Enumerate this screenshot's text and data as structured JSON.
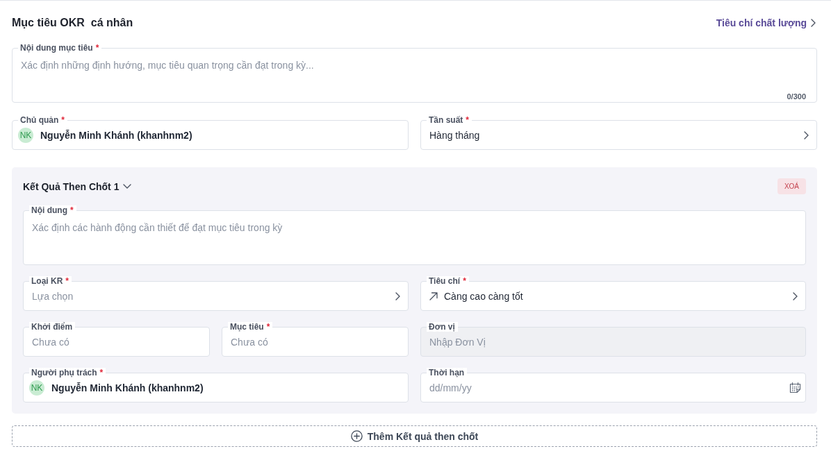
{
  "header": {
    "title": "Mục tiêu OKR  cá nhân",
    "link": "Tiêu chí chất lượng"
  },
  "objective": {
    "label": "Nội dung mục tiêu",
    "required_mark": "*",
    "placeholder": "Xác định những định hướng, mục tiêu quan trọng cần đạt trong kỳ...",
    "counter": "0/300"
  },
  "objective_fields": [
    {
      "kind": "person",
      "label": "Chủ quản",
      "required_mark": "*",
      "avatar": "NK",
      "value": "Nguyễn Minh Khánh (khanhnm2)"
    },
    {
      "kind": "select",
      "label": "Tần suất",
      "required_mark": "*",
      "value": "Hàng tháng"
    }
  ],
  "key_results": [
    {
      "title": "Kết Quả Then Chốt 1",
      "expanded": true,
      "delete_button": "XOÁ",
      "content": {
        "label": "Nội dung",
        "required_mark": "*",
        "placeholder": "Xác định các hành động cần thiết để đạt mục tiêu trong kỳ"
      },
      "fields": [
        {
          "kind": "select",
          "label": "Loại KR",
          "required_mark": "*",
          "placeholder": "Lựa chọn",
          "disabled": false
        },
        {
          "kind": "trend",
          "label": "Tiêu chí",
          "required_mark": "*",
          "value": "Càng cao càng tốt",
          "disabled": false
        },
        {
          "kind": "number",
          "label": "Khởi điểm",
          "placeholder": "Chưa có",
          "disabled": false
        },
        {
          "kind": "number",
          "label": "Mục tiêu",
          "required_mark": "*",
          "placeholder": "Chưa có",
          "disabled": false
        },
        {
          "kind": "text",
          "label": "Đơn vị",
          "placeholder": "Nhập Đơn Vị",
          "disabled": true
        },
        {
          "kind": "person",
          "label": "Người phụ trách",
          "required_mark": "*",
          "avatar": "NK",
          "value": "Nguyễn Minh Khánh (khanhnm2)",
          "disabled": false
        },
        {
          "kind": "date",
          "label": "Thời hạn",
          "placeholder": "dd/mm/yy",
          "disabled": false
        }
      ]
    }
  ],
  "add_button": "Thêm Kết quả then chốt"
}
